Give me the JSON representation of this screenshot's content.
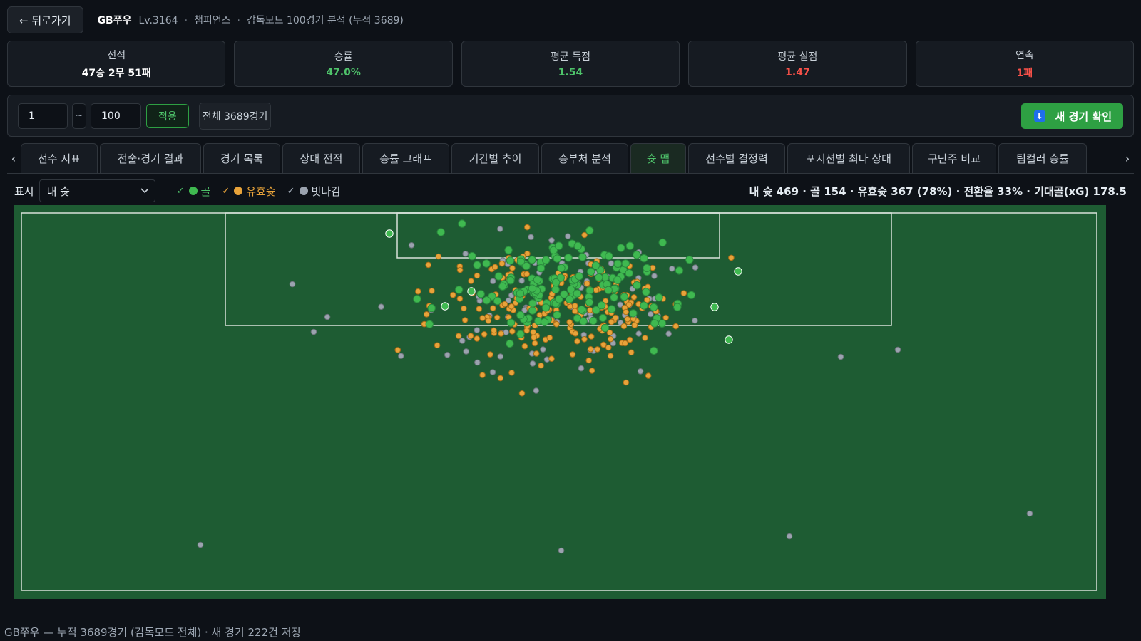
{
  "header": {
    "back_label": "← 뒤로가기",
    "user_name": "GB쭈우",
    "level": "Lv.3164",
    "tier": "챔피언스",
    "mode_desc": "감독모드 100경기 분석 (누적 3689)"
  },
  "stats": [
    {
      "label": "전적",
      "value": "47승 2무 51패",
      "tone": "white"
    },
    {
      "label": "승률",
      "value": "47.0%",
      "tone": "green"
    },
    {
      "label": "평균 득점",
      "value": "1.54",
      "tone": "green"
    },
    {
      "label": "평균 실점",
      "value": "1.47",
      "tone": "red"
    },
    {
      "label": "연속",
      "value": "1패",
      "tone": "red"
    }
  ],
  "range": {
    "from": "1",
    "tilde": "~",
    "to": "100",
    "apply_label": "적용",
    "all_label": "전체 3689경기",
    "new_games_label": "새 경기 확인"
  },
  "tabs": [
    {
      "label": "선수 지표",
      "active": false
    },
    {
      "label": "전술·경기 결과",
      "active": false
    },
    {
      "label": "경기 목록",
      "active": false
    },
    {
      "label": "상대 전적",
      "active": false
    },
    {
      "label": "승률 그래프",
      "active": false
    },
    {
      "label": "기간별 추이",
      "active": false
    },
    {
      "label": "승부처 분석",
      "active": false
    },
    {
      "label": "슛 맵",
      "active": true
    },
    {
      "label": "선수별 결정력",
      "active": false
    },
    {
      "label": "포지션별 최다 상대",
      "active": false
    },
    {
      "label": "구단주 비교",
      "active": false
    },
    {
      "label": "팀컬러 승률",
      "active": false
    }
  ],
  "shotmap": {
    "show_label": "표시",
    "select_value": "내 슛",
    "legend": [
      {
        "label": "골",
        "color": "#3fb950"
      },
      {
        "label": "유효슛",
        "color": "#e8a33a"
      },
      {
        "label": "빗나감",
        "color": "#9ba3af"
      }
    ],
    "summary": "내 슛 469 · 골 154 · 유효슛 367 (78%) · 전환율 33% · 기대골(xG) 178.5",
    "colors": {
      "pitch": "#1e5c33",
      "goal": "#3fb950",
      "on_target": "#e8a33a",
      "off_target": "#9ba3af"
    }
  },
  "footer": "GB쭈우 — 누적 3689경기 (감독모드 전체) · 새 경기 222건 저장"
}
